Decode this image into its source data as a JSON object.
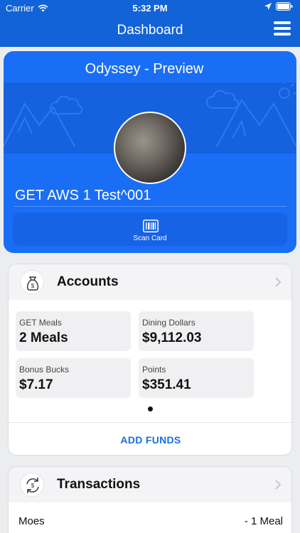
{
  "status_bar": {
    "carrier": "Carrier",
    "time": "5:32 PM"
  },
  "header": {
    "title": "Dashboard",
    "menu_icon": "hamburger-icon"
  },
  "card": {
    "institution": "Odyssey - Preview",
    "holder_name": "GET AWS 1 Test^001",
    "scan_label": "Scan Card"
  },
  "accounts": {
    "title": "Accounts",
    "tiles": [
      {
        "label": "GET Meals",
        "value": "2 Meals"
      },
      {
        "label": "Dining Dollars",
        "value": "$9,112.03"
      },
      {
        "label": "Bonus Bucks",
        "value": "$7.17"
      },
      {
        "label": "Points",
        "value": "$351.41"
      }
    ],
    "add_funds_label": "ADD FUNDS"
  },
  "transactions": {
    "title": "Transactions",
    "items": [
      {
        "name": "Moes",
        "amount": "- 1 Meal"
      }
    ]
  },
  "colors": {
    "primary": "#1263d8",
    "card": "#1a6ef5",
    "link": "#1a6ee0"
  }
}
